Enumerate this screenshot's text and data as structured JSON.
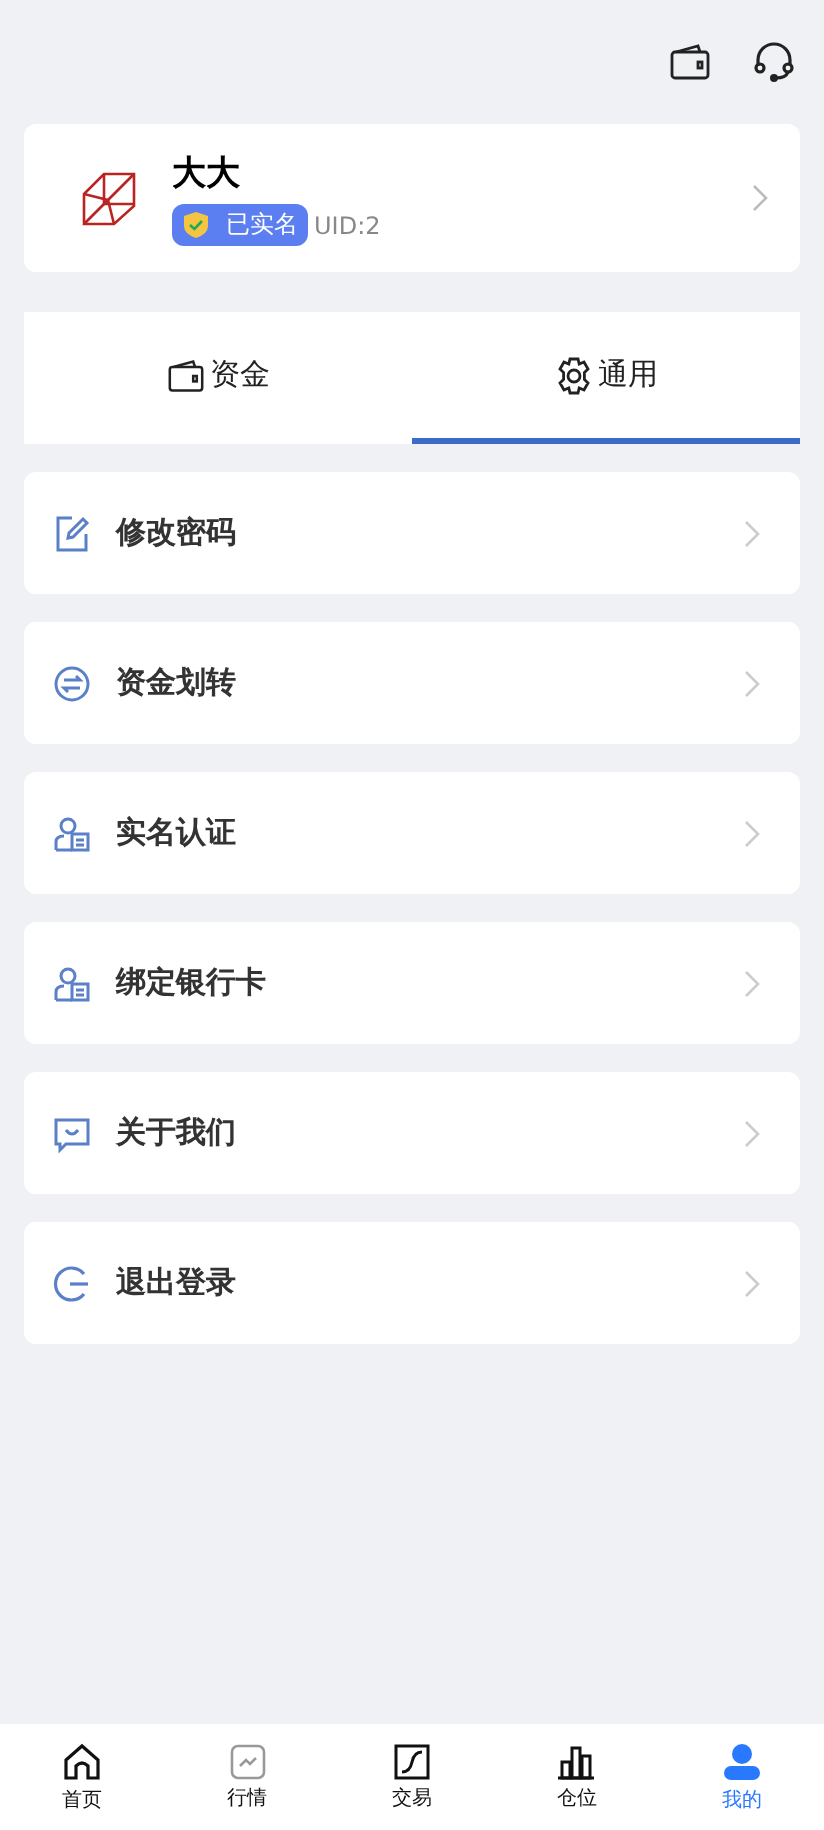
{
  "profile": {
    "name": "大大",
    "verified_badge": "已实名",
    "uid": "UID:2"
  },
  "tabs": [
    {
      "label": "资金",
      "kind": "wallet",
      "selected": false
    },
    {
      "label": "通用",
      "kind": "gear",
      "selected": true
    }
  ],
  "menu": [
    {
      "label": "修改密码",
      "kind": "edit"
    },
    {
      "label": "资金划转",
      "kind": "transfer"
    },
    {
      "label": "实名认证",
      "kind": "id"
    },
    {
      "label": "绑定银行卡",
      "kind": "id"
    },
    {
      "label": "关于我们",
      "kind": "message"
    },
    {
      "label": "退出登录",
      "kind": "logout"
    }
  ],
  "bottom_nav": [
    {
      "label": "首页",
      "kind": "home",
      "selected": false
    },
    {
      "label": "行情",
      "kind": "chart",
      "selected": false
    },
    {
      "label": "交易",
      "kind": "trade",
      "selected": false
    },
    {
      "label": "仓位",
      "kind": "bars",
      "selected": false
    },
    {
      "label": "我的",
      "kind": "person",
      "selected": true
    }
  ]
}
